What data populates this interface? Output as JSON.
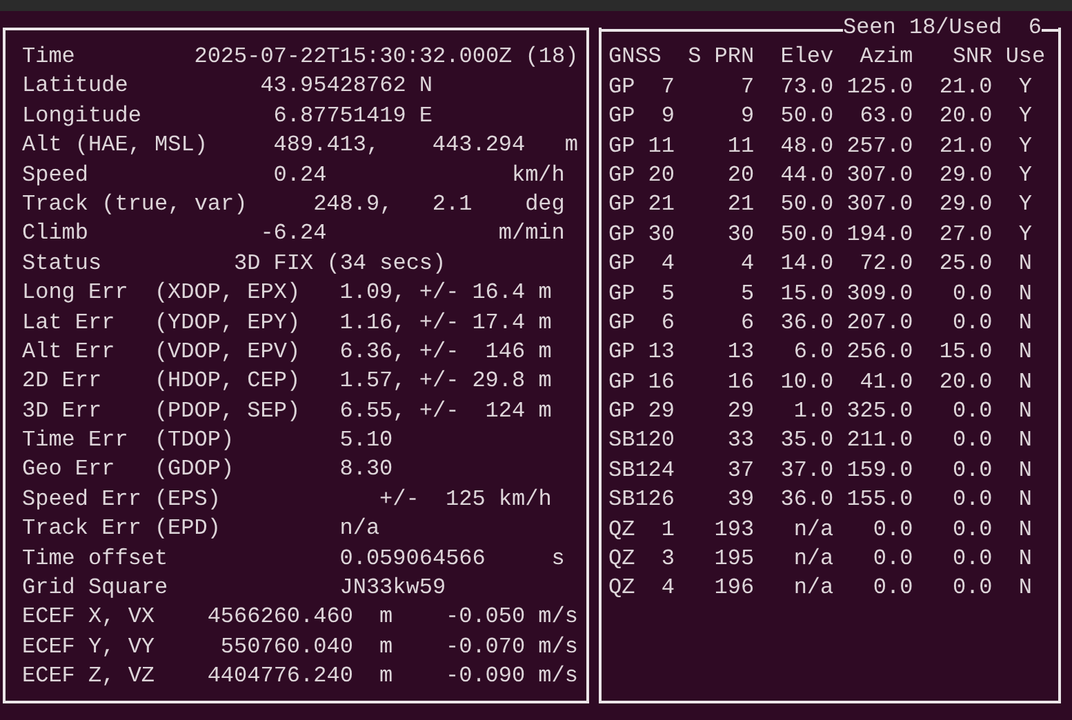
{
  "fix_panel": {
    "rows": [
      {
        "label": "Time",
        "values": [
          "2025-07-22T15:30:32.000Z (18)"
        ]
      },
      {
        "label": "Latitude",
        "values": [
          "43.95428762 N"
        ]
      },
      {
        "label": "Longitude",
        "values": [
          "6.87751419 E"
        ]
      },
      {
        "label": "Alt (HAE, MSL)",
        "values": [
          "489.413,",
          "443.294",
          "m"
        ]
      },
      {
        "label": "Speed",
        "values": [
          "0.24",
          "km/h"
        ]
      },
      {
        "label": "Track (true, var)",
        "values": [
          "248.9,",
          "2.1",
          "deg"
        ]
      },
      {
        "label": "Climb",
        "values": [
          "-6.24",
          "m/min"
        ]
      },
      {
        "label": "Status",
        "values": [
          "3D FIX (34 secs)"
        ]
      },
      {
        "label": "Long Err",
        "values": [
          "(XDOP, EPX)",
          "1.09, +/-",
          "16.4 m"
        ]
      },
      {
        "label": "Lat Err",
        "values": [
          "(YDOP, EPY)",
          "1.16, +/-",
          "17.4 m"
        ]
      },
      {
        "label": "Alt Err",
        "values": [
          "(VDOP, EPV)",
          "6.36, +/-",
          "146 m"
        ]
      },
      {
        "label": "2D Err",
        "values": [
          "(HDOP, CEP)",
          "1.57, +/-",
          "29.8 m"
        ]
      },
      {
        "label": "3D Err",
        "values": [
          "(PDOP, SEP)",
          "6.55, +/-",
          "124 m"
        ]
      },
      {
        "label": "Time Err",
        "values": [
          "(TDOP)",
          "5.10"
        ]
      },
      {
        "label": "Geo Err",
        "values": [
          "(GDOP)",
          "8.30"
        ]
      },
      {
        "label": "Speed Err",
        "values": [
          "(EPS)",
          "+/-",
          "125 km/h"
        ]
      },
      {
        "label": "Track Err",
        "values": [
          "(EPD)",
          "n/a"
        ]
      },
      {
        "label": "Time offset",
        "values": [
          "0.059064566",
          "s"
        ]
      },
      {
        "label": "Grid Square",
        "values": [
          "JN33kw59"
        ]
      },
      {
        "label": "ECEF X, VX",
        "values": [
          "4566260.460",
          "m",
          "-0.050",
          "m/s"
        ]
      },
      {
        "label": "ECEF Y, VY",
        "values": [
          "550760.040",
          "m",
          "-0.070",
          "m/s"
        ]
      },
      {
        "label": "ECEF Z, VZ",
        "values": [
          "4404776.240",
          "m",
          "-0.090",
          "m/s"
        ]
      }
    ]
  },
  "satellite_panel": {
    "title": "Seen 18/Used  6",
    "columns": [
      "GNSS",
      "S",
      "PRN",
      "Elev",
      "Azim",
      "SNR",
      "Use"
    ],
    "rows": [
      {
        "gnss": "GP",
        "s": "7",
        "prn": "7",
        "elev": "73.0",
        "azim": "125.0",
        "snr": "21.0",
        "use": "Y"
      },
      {
        "gnss": "GP",
        "s": "9",
        "prn": "9",
        "elev": "50.0",
        "azim": "63.0",
        "snr": "20.0",
        "use": "Y"
      },
      {
        "gnss": "GP",
        "s": "11",
        "prn": "11",
        "elev": "48.0",
        "azim": "257.0",
        "snr": "21.0",
        "use": "Y"
      },
      {
        "gnss": "GP",
        "s": "20",
        "prn": "20",
        "elev": "44.0",
        "azim": "307.0",
        "snr": "29.0",
        "use": "Y"
      },
      {
        "gnss": "GP",
        "s": "21",
        "prn": "21",
        "elev": "50.0",
        "azim": "307.0",
        "snr": "29.0",
        "use": "Y"
      },
      {
        "gnss": "GP",
        "s": "30",
        "prn": "30",
        "elev": "50.0",
        "azim": "194.0",
        "snr": "27.0",
        "use": "Y"
      },
      {
        "gnss": "GP",
        "s": "4",
        "prn": "4",
        "elev": "14.0",
        "azim": "72.0",
        "snr": "25.0",
        "use": "N"
      },
      {
        "gnss": "GP",
        "s": "5",
        "prn": "5",
        "elev": "15.0",
        "azim": "309.0",
        "snr": "0.0",
        "use": "N"
      },
      {
        "gnss": "GP",
        "s": "6",
        "prn": "6",
        "elev": "36.0",
        "azim": "207.0",
        "snr": "0.0",
        "use": "N"
      },
      {
        "gnss": "GP",
        "s": "13",
        "prn": "13",
        "elev": "6.0",
        "azim": "256.0",
        "snr": "15.0",
        "use": "N"
      },
      {
        "gnss": "GP",
        "s": "16",
        "prn": "16",
        "elev": "10.0",
        "azim": "41.0",
        "snr": "20.0",
        "use": "N"
      },
      {
        "gnss": "GP",
        "s": "29",
        "prn": "29",
        "elev": "1.0",
        "azim": "325.0",
        "snr": "0.0",
        "use": "N"
      },
      {
        "gnss": "SB",
        "s": "120",
        "prn": "33",
        "elev": "35.0",
        "azim": "211.0",
        "snr": "0.0",
        "use": "N"
      },
      {
        "gnss": "SB",
        "s": "124",
        "prn": "37",
        "elev": "37.0",
        "azim": "159.0",
        "snr": "0.0",
        "use": "N"
      },
      {
        "gnss": "SB",
        "s": "126",
        "prn": "39",
        "elev": "36.0",
        "azim": "155.0",
        "snr": "0.0",
        "use": "N"
      },
      {
        "gnss": "QZ",
        "s": "1",
        "prn": "193",
        "elev": "n/a",
        "azim": "0.0",
        "snr": "0.0",
        "use": "N"
      },
      {
        "gnss": "QZ",
        "s": "3",
        "prn": "195",
        "elev": "n/a",
        "azim": "0.0",
        "snr": "0.0",
        "use": "N"
      },
      {
        "gnss": "QZ",
        "s": "4",
        "prn": "196",
        "elev": "n/a",
        "azim": "0.0",
        "snr": "0.0",
        "use": "N"
      }
    ]
  }
}
